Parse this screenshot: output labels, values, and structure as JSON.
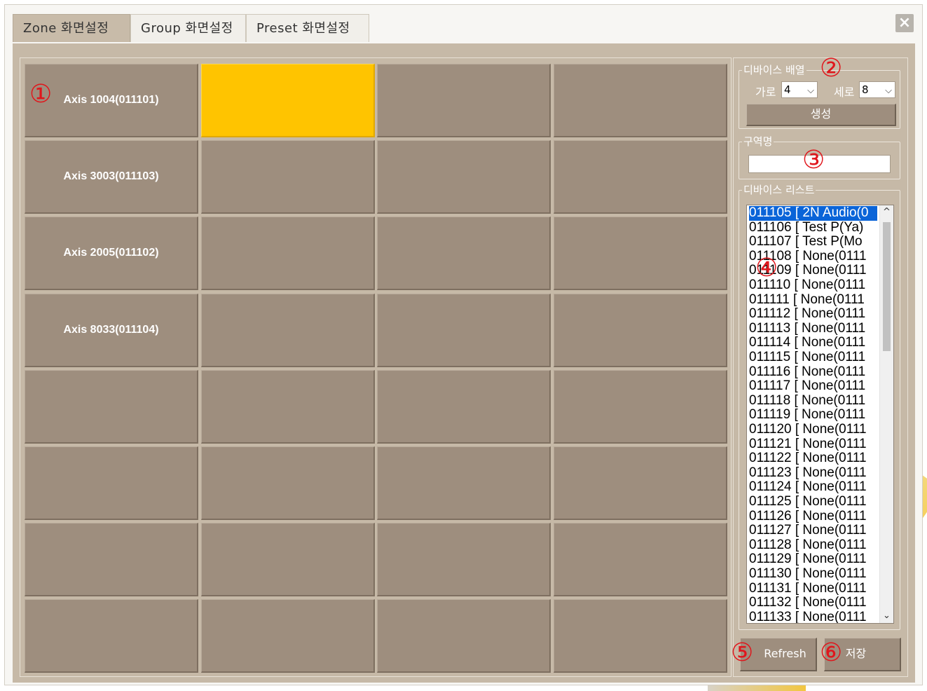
{
  "tabs": [
    {
      "label": "Zone 화면설정",
      "active": true
    },
    {
      "label": "Group 화면설정",
      "active": false
    },
    {
      "label": "Preset 화면설정",
      "active": false
    }
  ],
  "close_icon": "×",
  "grid": {
    "cols": 4,
    "rows": 8,
    "labels": [
      [
        "Axis 1004(011101)",
        "",
        "",
        ""
      ],
      [
        "Axis 3003(011103)",
        "",
        "",
        ""
      ],
      [
        "Axis 2005(011102)",
        "",
        "",
        ""
      ],
      [
        "Axis 8033(011104)",
        "",
        "",
        ""
      ],
      [
        "",
        "",
        "",
        ""
      ],
      [
        "",
        "",
        "",
        ""
      ],
      [
        "",
        "",
        "",
        ""
      ],
      [
        "",
        "",
        "",
        ""
      ]
    ],
    "selected": {
      "row": 0,
      "col": 1
    },
    "colors": {
      "cell": "#9e8e7e",
      "selected": "#ffc400"
    }
  },
  "device_layout": {
    "legend": "디바이스 배열",
    "horizontal_label": "가로",
    "horizontal_value": "4",
    "vertical_label": "세로",
    "vertical_value": "8",
    "create_button": "생성"
  },
  "zone_name": {
    "legend": "구역명",
    "value": ""
  },
  "device_list": {
    "legend": "디바이스 리스트",
    "items": [
      "011105 [ 2N Audio(0",
      "011106 [ Test P(Ya)",
      "011107 [ Test P(Mo",
      "011108 [ None(0111",
      "011109 [ None(0111",
      "011110 [ None(0111",
      "011111 [ None(0111",
      "011112 [ None(0111",
      "011113 [ None(0111",
      "011114 [ None(0111",
      "011115 [ None(0111",
      "011116 [ None(0111",
      "011117 [ None(0111",
      "011118 [ None(0111",
      "011119 [ None(0111",
      "011120 [ None(0111",
      "011121 [ None(0111",
      "011122 [ None(0111",
      "011123 [ None(0111",
      "011124 [ None(0111",
      "011125 [ None(0111",
      "011126 [ None(0111",
      "011127 [ None(0111",
      "011128 [ None(0111",
      "011129 [ None(0111",
      "011130 [ None(0111",
      "011131 [ None(0111",
      "011132 [ None(0111",
      "011133 [ None(0111"
    ],
    "selected_index": 0
  },
  "buttons": {
    "refresh": "Refresh",
    "save": "저장"
  },
  "markers": [
    "①",
    "②",
    "③",
    "④",
    "⑤",
    "⑥"
  ],
  "dropdown_arrow": "⌵",
  "scroll_up": "^",
  "scroll_down": "⌄"
}
